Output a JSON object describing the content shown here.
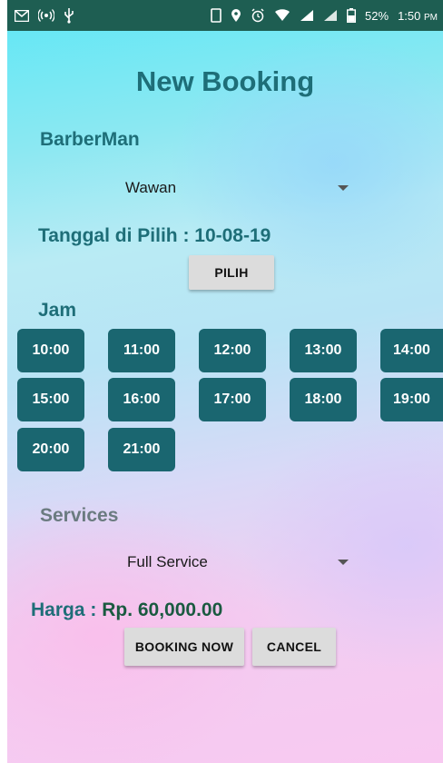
{
  "status_bar": {
    "battery": "52%",
    "time": "1:50",
    "ampm": "PM"
  },
  "page": {
    "title": "New Booking"
  },
  "barber": {
    "label": "BarberMan",
    "selected": "Wawan"
  },
  "date": {
    "label": "Tanggal di Pilih : 10-08-19",
    "button": "PILIH"
  },
  "time": {
    "label": "Jam",
    "slots": [
      "10:00",
      "11:00",
      "12:00",
      "13:00",
      "14:00",
      "15:00",
      "16:00",
      "17:00",
      "18:00",
      "19:00",
      "20:00",
      "21:00"
    ]
  },
  "services": {
    "label": "Services",
    "selected": "Full Service"
  },
  "price": {
    "label": "Harga :",
    "value": "Rp. 60,000.00"
  },
  "actions": {
    "booking": "BOOKING NOW",
    "cancel": "CANCEL"
  },
  "colors": {
    "status_bar": "#1e5e52",
    "accent": "#1e6e78",
    "slot": "#1a6670",
    "button": "#dcdcdc"
  }
}
